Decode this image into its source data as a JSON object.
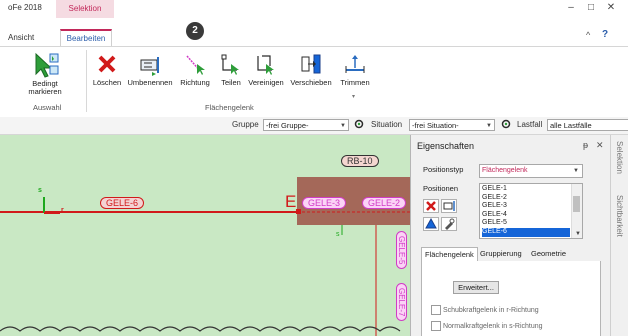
{
  "title_bar": {
    "app_title": "oFe 2018",
    "context_tab": "Selektion",
    "minimize": "–",
    "maximize": "□",
    "close": "✕",
    "help": "?"
  },
  "tabs": {
    "ansicht": "Ansicht",
    "bearbeiten": "Bearbeiten"
  },
  "ribbon": {
    "buttons": {
      "bedingt": "Bedingt markieren",
      "bedingt_l1": "Bedingt",
      "bedingt_l2": "markieren",
      "loeschen": "Löschen",
      "umbenennen": "Umbenennen",
      "richtung": "Richtung",
      "teilen": "Teilen",
      "vereinigen": "Vereinigen",
      "verschieben": "Verschieben",
      "trimmen": "Trimmen"
    },
    "groups": {
      "auswahl": "Auswahl",
      "flaechengelenk": "Flächengelenk"
    },
    "badge": "2"
  },
  "filter_bar": {
    "gruppe_label": "Gruppe",
    "gruppe_value": "-frei Gruppe-",
    "situation_label": "Situation",
    "situation_value": "-frei Situation-",
    "lastfall_label": "Lastfall",
    "lastfall_value": "alle Lastfälle"
  },
  "canvas": {
    "labels": {
      "rb10": "RB-10",
      "gele6": "GELE-6",
      "gele3": "GELE-3",
      "gele2": "GELE-2",
      "gele_v1": "GELE-5",
      "gele_v2": "GELE-7",
      "axis_s": "s",
      "axis_r": "r",
      "e_letter": "E"
    }
  },
  "panel": {
    "title": "Eigenschaften",
    "pin": "ᵽ",
    "close": "✕",
    "positionstyp_label": "Positionstyp",
    "positionstyp_value": "Flächengelenk",
    "positionen_label": "Positionen",
    "positions": [
      "GELE-1",
      "GELE-2",
      "GELE-3",
      "GELE-4",
      "GELE-5",
      "GELE-6"
    ],
    "selected_position": "GELE-6",
    "subtabs": [
      "Flächengelenk",
      "Gruppierung",
      "Geometrie"
    ],
    "erweitert_button": "Erweitert...",
    "checkboxes": [
      "Schubkraftgelenk in r-Richtung",
      "Normalkraftgelenk in s-Richtung"
    ]
  },
  "sidebar_strip": {
    "items": [
      "Selektion",
      "Sichtbarkeit"
    ]
  },
  "colors": {
    "accent": "#c2285a",
    "canvas_bg": "#c9e8c4",
    "red_line": "#d11a1a",
    "slab": "#a05a4e",
    "label_pink": "#d13cc6",
    "list_highlight": "#1565d8"
  }
}
